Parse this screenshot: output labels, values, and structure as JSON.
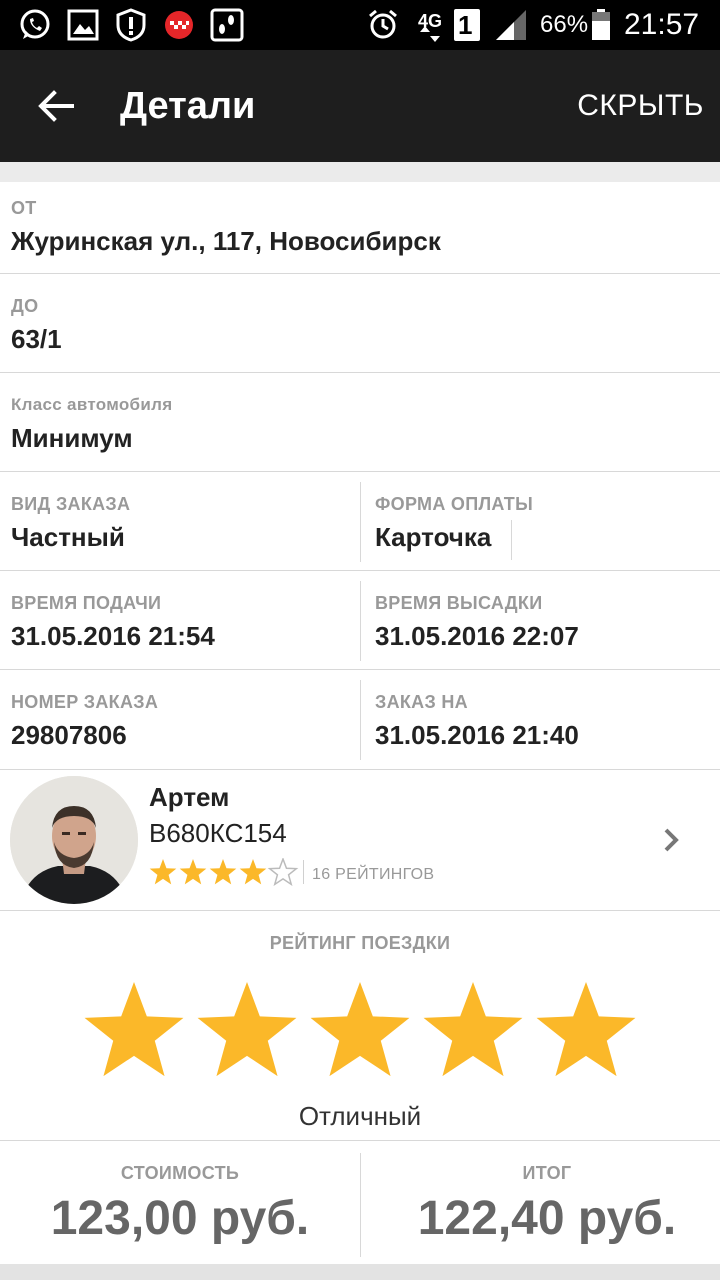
{
  "status_bar": {
    "battery": "66%",
    "time": "21:57",
    "network": "4G",
    "sim": "1"
  },
  "appbar": {
    "title": "Детали",
    "hide_label": "СКРЫТЬ"
  },
  "from": {
    "label": "ОТ",
    "value": "Журинская ул., 117, Новосибирск"
  },
  "to": {
    "label": "ДО",
    "value": "63/1"
  },
  "car_class": {
    "label": "Класс автомобиля",
    "value": "Минимум"
  },
  "order_type": {
    "label": "ВИД ЗАКАЗА",
    "value": "Частный"
  },
  "payment": {
    "label": "ФОРМА ОПЛАТЫ",
    "value": "Карточка"
  },
  "pickup_time": {
    "label": "ВРЕМЯ ПОДАЧИ",
    "value": "31.05.2016 21:54"
  },
  "dropoff_time": {
    "label": "ВРЕМЯ ВЫСАДКИ",
    "value": "31.05.2016 22:07"
  },
  "order_number": {
    "label": "НОМЕР ЗАКАЗА",
    "value": "29807806"
  },
  "order_for": {
    "label": "ЗАКАЗ НА",
    "value": "31.05.2016 21:40"
  },
  "driver": {
    "name": "Артем",
    "plate": "В680КС154",
    "rating_stars": 4,
    "rating_max": 5,
    "rating_count": "16 РЕЙТИНГОВ"
  },
  "trip_rating": {
    "label": "РЕЙТИНГ ПОЕЗДКИ",
    "stars": 5,
    "max": 5,
    "word": "Отличный"
  },
  "cost": {
    "label": "СТОИМОСТЬ",
    "value": "123,00 руб."
  },
  "total": {
    "label": "ИТОГ",
    "value": "122,40 руб."
  },
  "colors": {
    "star": "#fbb829",
    "appbar": "#1e1e1e",
    "label_gray": "#999999"
  }
}
